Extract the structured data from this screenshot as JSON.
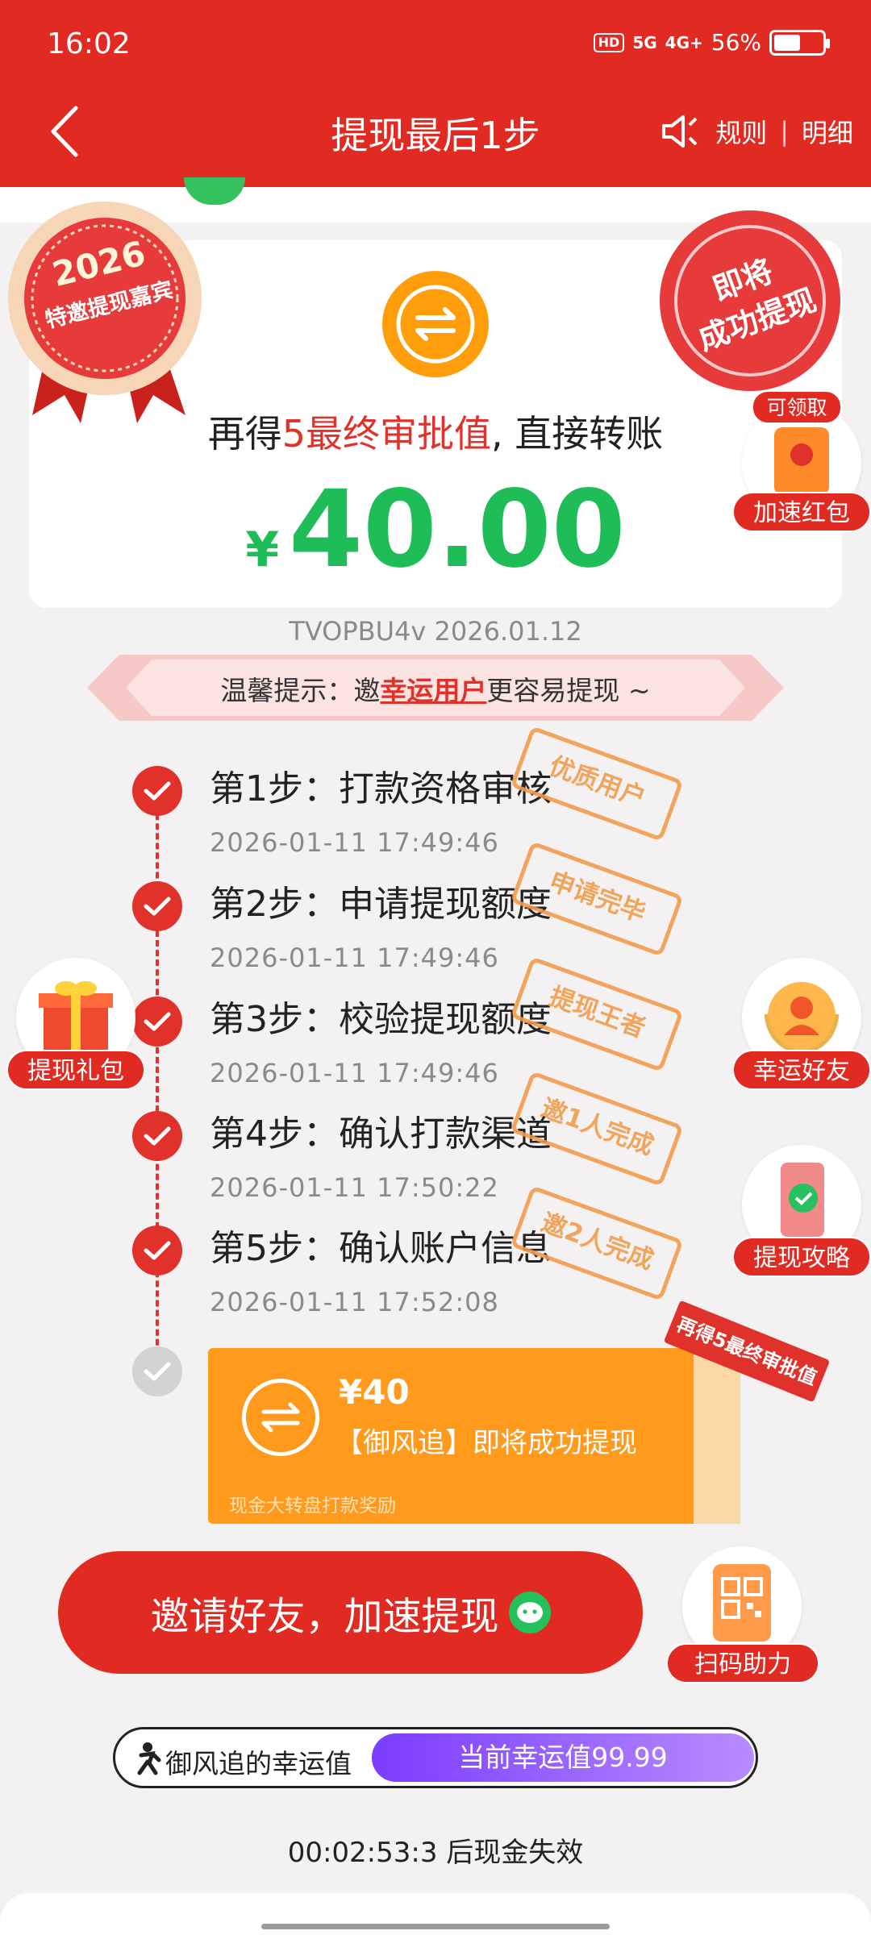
{
  "status_bar": {
    "time": "16:02",
    "hd": "HD",
    "net5g": "5G",
    "net4g": "4G+",
    "battery": "56%",
    "battery_level": 0.56
  },
  "header": {
    "title": "提现最后1步",
    "rules": "规则",
    "separator": "|",
    "details": "明细"
  },
  "badges": {
    "left_year": "2026",
    "left_text": "特邀提现嘉宾",
    "right_text_1": "即将",
    "right_text_2": "成功提现"
  },
  "card": {
    "sub_pre": "再得",
    "sub_red": "5最终审批值",
    "sub_post": ", 直接转账",
    "currency": "¥",
    "amount": "40.00"
  },
  "code_line": "TVOPBU4v 2026.01.12",
  "tip": {
    "pre": "温馨提示：邀",
    "link": "幸运用户",
    "post": "更容易提现 ~"
  },
  "side": {
    "claim_tag": "可领取",
    "speed_packet": "加速红包",
    "gift": "提现礼包",
    "lucky_friend": "幸运好友",
    "guide": "提现攻略",
    "scan": "扫码助力"
  },
  "steps": [
    {
      "title": "第1步：打款资格审核",
      "time": "2026-01-11 17:49:46",
      "stamp": "优质用户"
    },
    {
      "title": "第2步：申请提现额度",
      "time": "2026-01-11 17:49:46",
      "stamp": "申请完毕"
    },
    {
      "title": "第3步：校验提现额度",
      "time": "2026-01-11 17:49:46",
      "stamp": "提现王者"
    },
    {
      "title": "第4步：确认打款渠道",
      "time": "2026-01-11 17:50:22",
      "stamp": "邀1人完成"
    },
    {
      "title": "第5步：确认账户信息",
      "time": "2026-01-11 17:52:08",
      "stamp": "邀2人完成"
    }
  ],
  "reward": {
    "amount": "¥40",
    "desc": "【御风追】即将成功提现",
    "foot": "现金大转盘打款奖励",
    "ribbon": "再得5最终审批值"
  },
  "invite_button": "邀请好友，加速提现",
  "luck": {
    "label": "御风追的幸运值",
    "value": "当前幸运值99.99"
  },
  "countdown": "00:02:53:3 后现金失效",
  "colors": {
    "brand_red": "#e02a22",
    "green": "#1fbd58",
    "orange": "#ff9a1c",
    "purple": "#7b3cff"
  }
}
